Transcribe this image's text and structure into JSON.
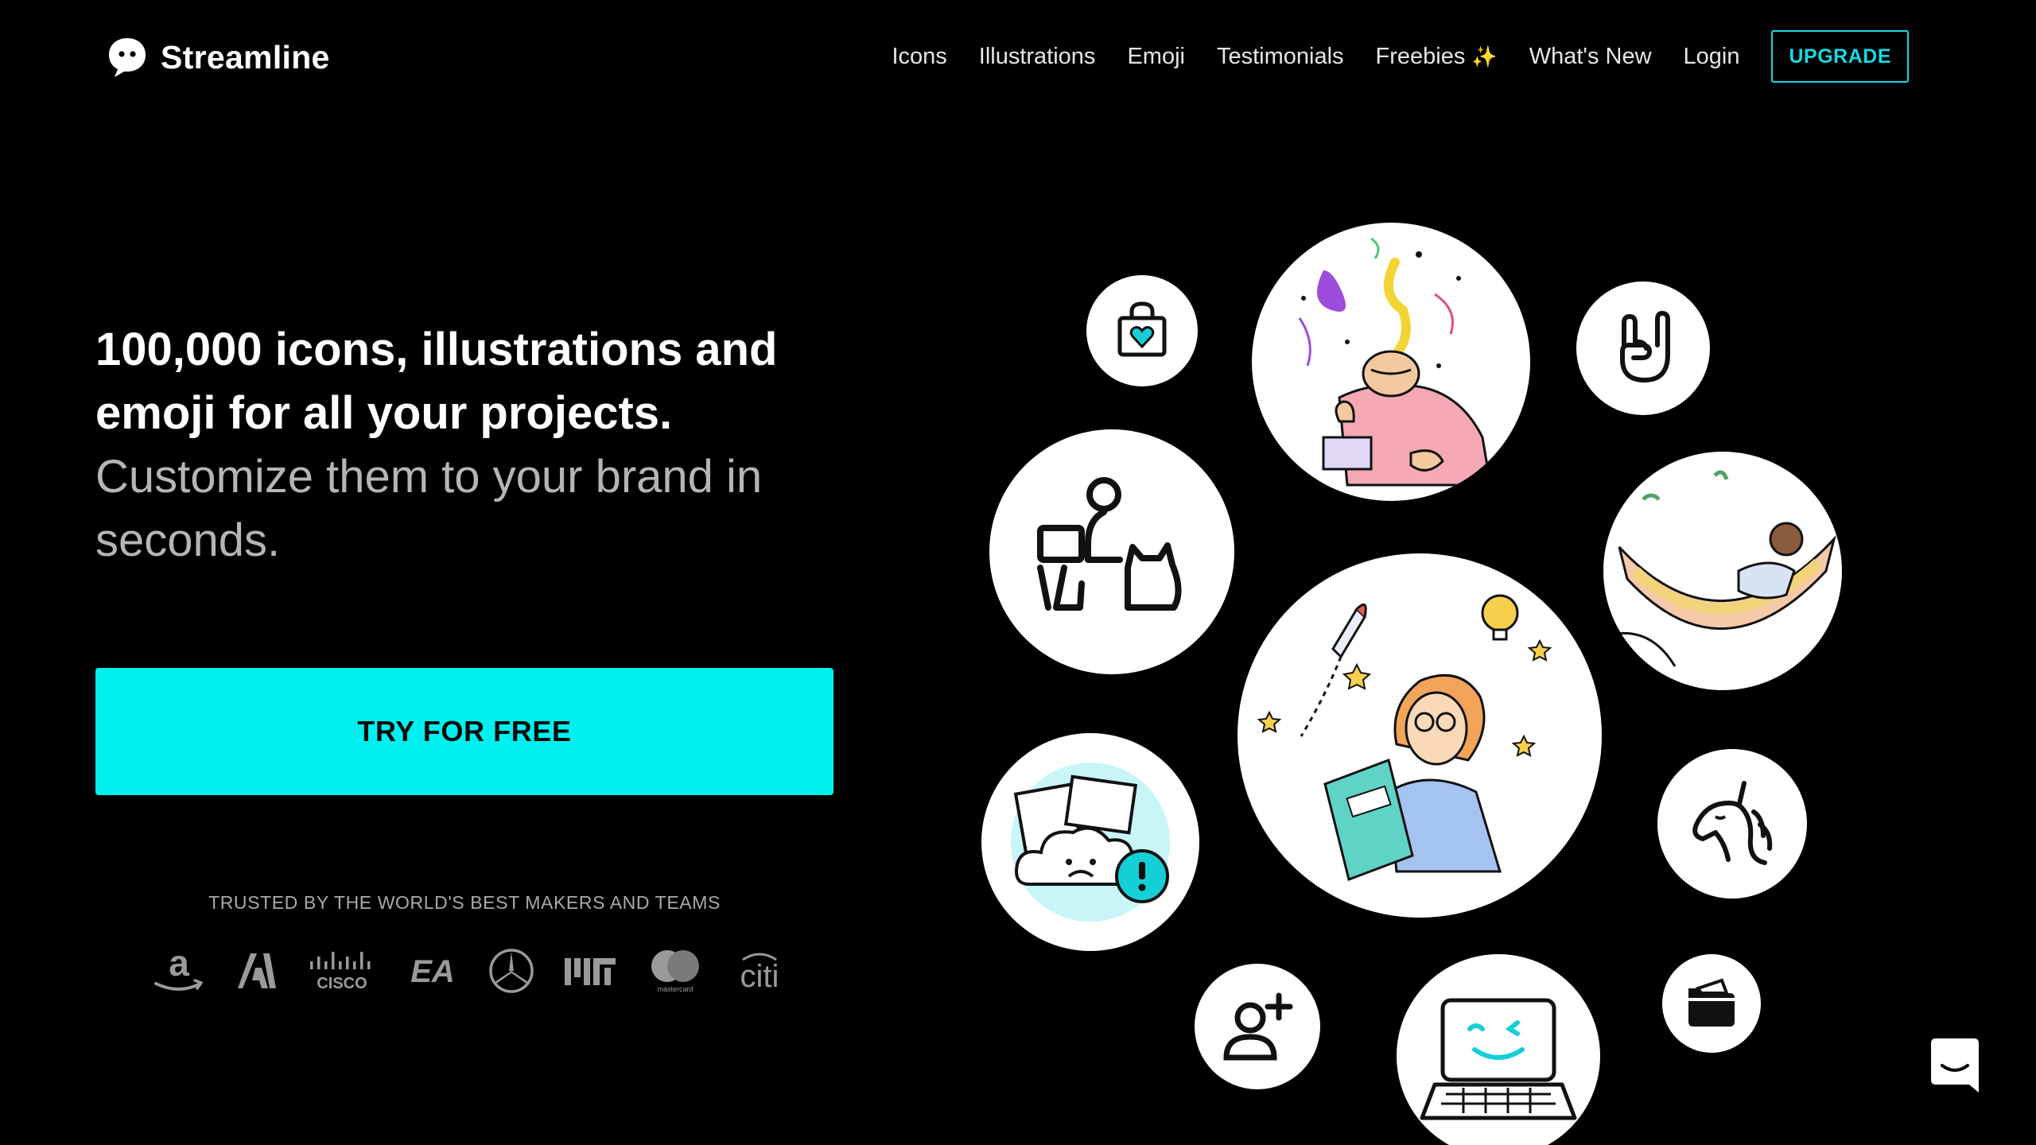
{
  "brand": {
    "name": "Streamline",
    "logo_icon": "chat-bubble-face-icon"
  },
  "nav": {
    "items": [
      "Icons",
      "Illustrations",
      "Emoji",
      "Testimonials",
      "Freebies",
      "What's New",
      "Login"
    ],
    "freebies_badge_icon": "sparkle-icon",
    "upgrade_label": "UPGRADE"
  },
  "hero": {
    "headline": "100,000 icons, illustrations and emoji for all your projects.",
    "subheadline": "Customize them to your brand in seconds.",
    "cta_label": "TRY FOR FREE",
    "trusted_label": "TRUSTED BY THE WORLD'S BEST MAKERS AND TEAMS",
    "brand_logos": [
      "amazon",
      "adobe",
      "cisco",
      "ea",
      "mercedes-benz",
      "mit",
      "mastercard",
      "citi"
    ],
    "cisco_text": "CISCO",
    "citi_text": "citi",
    "ea_text": "EA",
    "mastercard_text": "mastercard"
  },
  "showcase": {
    "items": [
      "shopping-bag-heart-icon",
      "mind-blown-illustration",
      "rock-hand-icon",
      "remote-work-cat-icon",
      "hammock-relax-illustration",
      "reading-ideas-illustration",
      "cloud-error-illustration",
      "unicorn-icon",
      "add-user-icon",
      "happy-laptop-illustration",
      "open-folder-icon"
    ]
  },
  "colors": {
    "background": "#000000",
    "accent": "#00f0f0",
    "upgrade_border": "#16d9e3",
    "muted_text": "#b5b5b5"
  },
  "chat_widget_icon": "chat-widget-icon"
}
